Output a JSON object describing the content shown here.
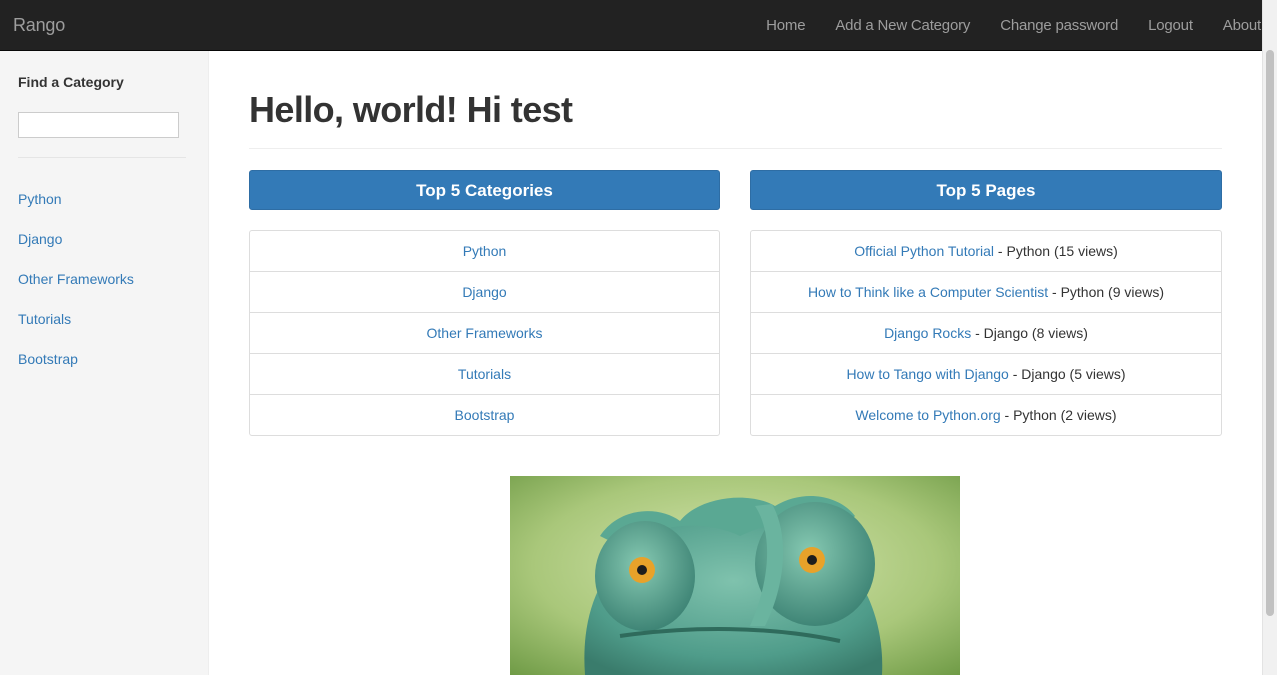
{
  "navbar": {
    "brand": "Rango",
    "items": [
      {
        "label": "Home"
      },
      {
        "label": "Add a New Category"
      },
      {
        "label": "Change password"
      },
      {
        "label": "Logout"
      },
      {
        "label": "About"
      }
    ]
  },
  "sidebar": {
    "title": "Find a Category",
    "search_value": "",
    "links": [
      {
        "label": "Python"
      },
      {
        "label": "Django"
      },
      {
        "label": "Other Frameworks"
      },
      {
        "label": "Tutorials"
      },
      {
        "label": "Bootstrap"
      }
    ]
  },
  "main": {
    "title": "Hello, world! Hi test",
    "top_categories": {
      "heading": "Top 5 Categories",
      "items": [
        {
          "label": "Python"
        },
        {
          "label": "Django"
        },
        {
          "label": "Other Frameworks"
        },
        {
          "label": "Tutorials"
        },
        {
          "label": "Bootstrap"
        }
      ]
    },
    "top_pages": {
      "heading": "Top 5 Pages",
      "items": [
        {
          "title": "Official Python Tutorial",
          "suffix": " - Python (15 views)"
        },
        {
          "title": "How to Think like a Computer Scientist",
          "suffix": " - Python (9 views)"
        },
        {
          "title": "Django Rocks",
          "suffix": " - Django (8 views)"
        },
        {
          "title": "How to Tango with Django",
          "suffix": " - Django (5 views)"
        },
        {
          "title": "Welcome to Python.org",
          "suffix": " - Python (2 views)"
        }
      ]
    },
    "hero_image": {
      "subject": "chameleon-illustration"
    }
  },
  "colors": {
    "navbar_bg": "#222222",
    "nav_text": "#9d9d9d",
    "link": "#337ab7",
    "panel_heading_bg": "#337ab7",
    "sidebar_bg": "#f5f5f5"
  }
}
